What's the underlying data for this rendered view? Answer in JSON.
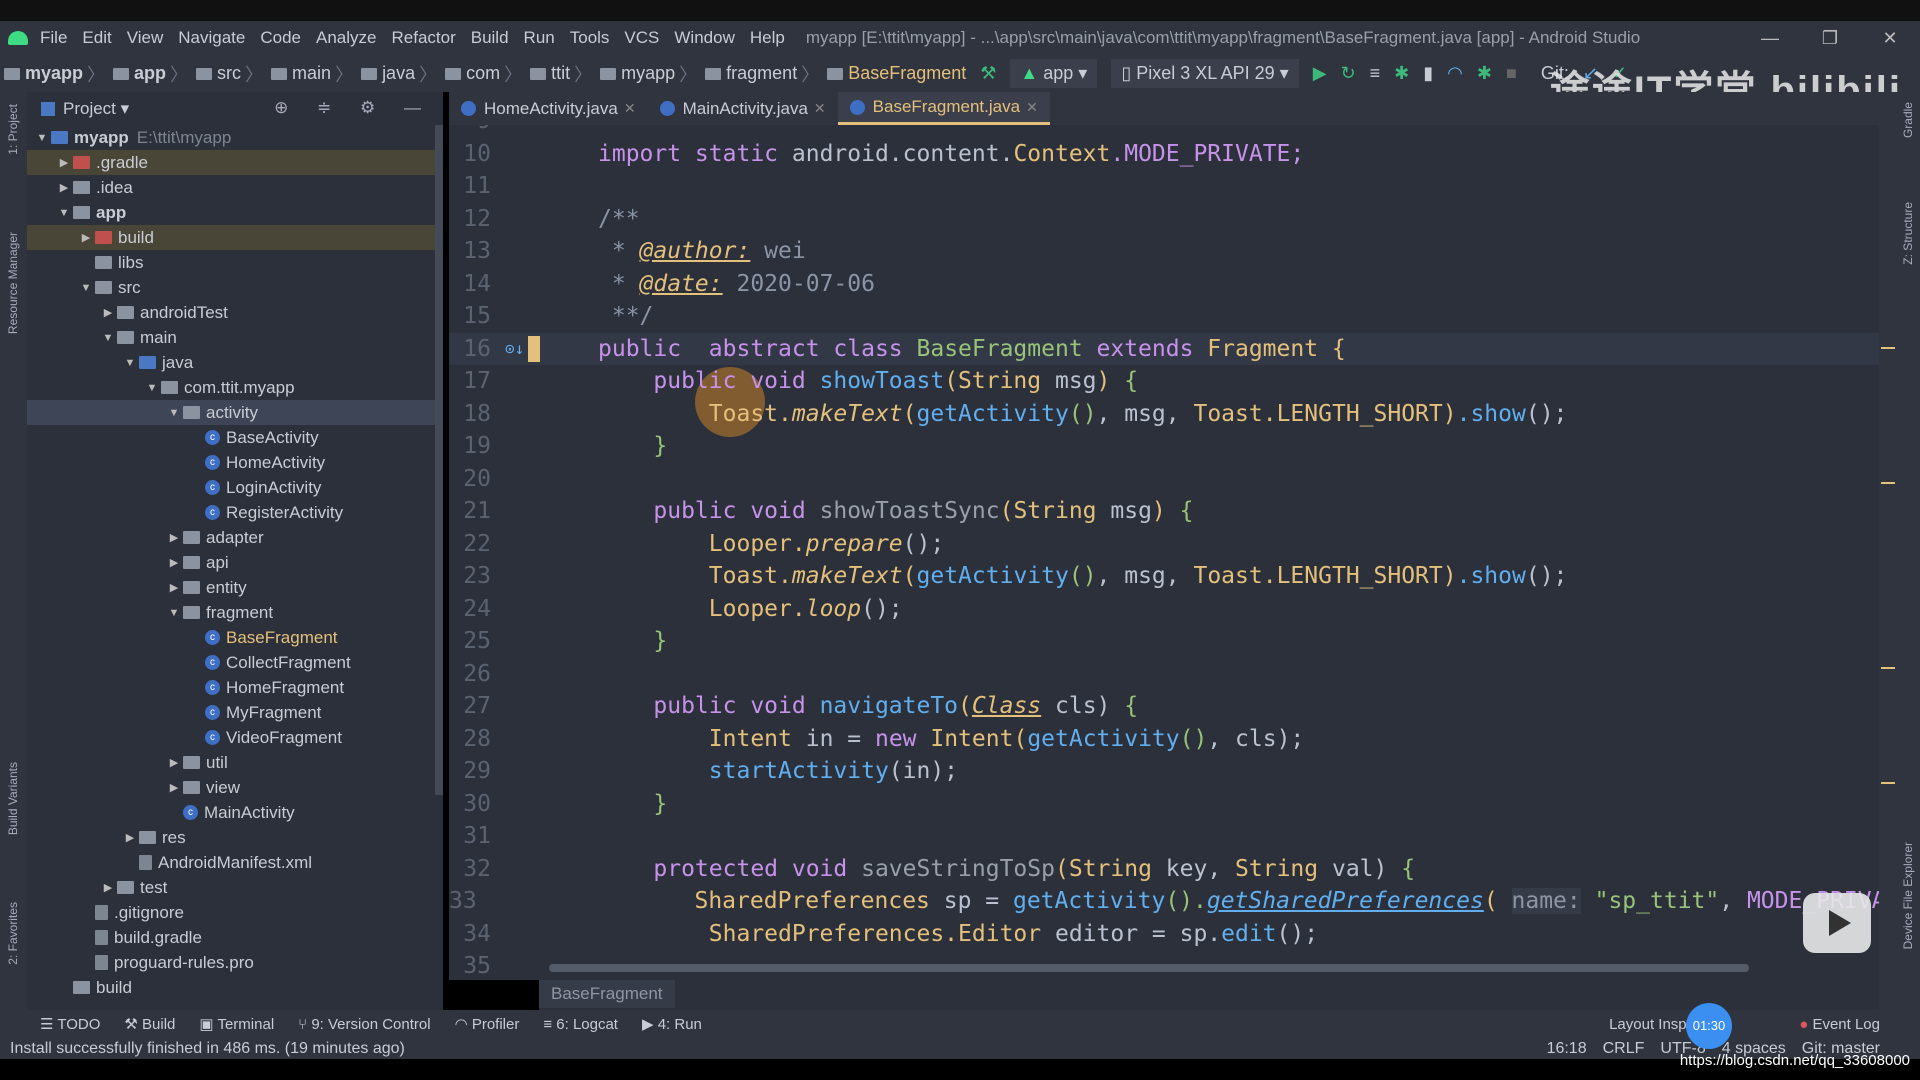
{
  "menu": {
    "items": [
      "File",
      "Edit",
      "View",
      "Navigate",
      "Code",
      "Analyze",
      "Refactor",
      "Build",
      "Run",
      "Tools",
      "VCS",
      "Window",
      "Help"
    ],
    "title": "myapp [E:\\ttit\\myapp] - ...\\app\\src\\main\\java\\com\\ttit\\myapp\\fragment\\BaseFragment.java [app] - Android Studio"
  },
  "breadcrumb": [
    "myapp",
    "app",
    "src",
    "main",
    "java",
    "com",
    "ttit",
    "myapp",
    "fragment",
    "BaseFragment"
  ],
  "toolbar": {
    "run_config": "app",
    "device": "Pixel 3 XL API 29",
    "git_label": "Git:"
  },
  "watermark": "途途IT学堂 bilibili",
  "project": {
    "title": "Project",
    "tree": [
      {
        "d": 0,
        "a": "▼",
        "i": "folderblue",
        "l": "myapp",
        "path": "E:\\ttit\\myapp",
        "b": true
      },
      {
        "d": 1,
        "a": "▶",
        "i": "folderred",
        "l": ".gradle",
        "hl": true
      },
      {
        "d": 1,
        "a": "▶",
        "i": "folder",
        "l": ".idea"
      },
      {
        "d": 1,
        "a": "▼",
        "i": "folder",
        "l": "app",
        "b": true
      },
      {
        "d": 2,
        "a": "▶",
        "i": "folderred",
        "l": "build",
        "hl": true
      },
      {
        "d": 2,
        "a": "",
        "i": "folder",
        "l": "libs"
      },
      {
        "d": 2,
        "a": "▼",
        "i": "folder",
        "l": "src"
      },
      {
        "d": 3,
        "a": "▶",
        "i": "folder",
        "l": "androidTest"
      },
      {
        "d": 3,
        "a": "▼",
        "i": "folder",
        "l": "main"
      },
      {
        "d": 4,
        "a": "▼",
        "i": "folderblue",
        "l": "java"
      },
      {
        "d": 5,
        "a": "▼",
        "i": "folder",
        "l": "com.ttit.myapp"
      },
      {
        "d": 6,
        "a": "▼",
        "i": "folder",
        "l": "activity",
        "sel": true
      },
      {
        "d": 7,
        "a": "",
        "i": "cls",
        "l": "BaseActivity"
      },
      {
        "d": 7,
        "a": "",
        "i": "cls",
        "l": "HomeActivity"
      },
      {
        "d": 7,
        "a": "",
        "i": "cls",
        "l": "LoginActivity"
      },
      {
        "d": 7,
        "a": "",
        "i": "cls",
        "l": "RegisterActivity"
      },
      {
        "d": 6,
        "a": "▶",
        "i": "folder",
        "l": "adapter"
      },
      {
        "d": 6,
        "a": "▶",
        "i": "folder",
        "l": "api"
      },
      {
        "d": 6,
        "a": "▶",
        "i": "folder",
        "l": "entity"
      },
      {
        "d": 6,
        "a": "▼",
        "i": "folder",
        "l": "fragment"
      },
      {
        "d": 7,
        "a": "",
        "i": "cls",
        "l": "BaseFragment",
        "active": true
      },
      {
        "d": 7,
        "a": "",
        "i": "cls",
        "l": "CollectFragment"
      },
      {
        "d": 7,
        "a": "",
        "i": "cls",
        "l": "HomeFragment"
      },
      {
        "d": 7,
        "a": "",
        "i": "cls",
        "l": "MyFragment"
      },
      {
        "d": 7,
        "a": "",
        "i": "cls",
        "l": "VideoFragment"
      },
      {
        "d": 6,
        "a": "▶",
        "i": "folder",
        "l": "util"
      },
      {
        "d": 6,
        "a": "▶",
        "i": "folder",
        "l": "view"
      },
      {
        "d": 6,
        "a": "",
        "i": "cls",
        "l": "MainActivity"
      },
      {
        "d": 4,
        "a": "▶",
        "i": "folder",
        "l": "res"
      },
      {
        "d": 4,
        "a": "",
        "i": "file",
        "l": "AndroidManifest.xml"
      },
      {
        "d": 3,
        "a": "▶",
        "i": "folder",
        "l": "test"
      },
      {
        "d": 2,
        "a": "",
        "i": "file",
        "l": ".gitignore"
      },
      {
        "d": 2,
        "a": "",
        "i": "file",
        "l": "build.gradle"
      },
      {
        "d": 2,
        "a": "",
        "i": "file",
        "l": "proguard-rules.pro"
      },
      {
        "d": 1,
        "a": "",
        "i": "folder",
        "l": "build"
      }
    ]
  },
  "left_tools": [
    "1: Project",
    "Resource Manager",
    "Build Variants",
    "2: Favorites"
  ],
  "right_tools": [
    "Gradle",
    "Z: Structure",
    "Device File Explorer"
  ],
  "tabs": [
    {
      "label": "HomeActivity.java"
    },
    {
      "label": "MainActivity.java"
    },
    {
      "label": "BaseFragment.java",
      "active": true
    }
  ],
  "code": [
    {
      "n": "9",
      "t": []
    },
    {
      "n": "10",
      "t": [
        [
          "import static ",
          "k"
        ],
        [
          "android.content.",
          "p"
        ],
        [
          "Context",
          "t"
        ],
        [
          ".MODE_PRIVATE;",
          "k"
        ]
      ]
    },
    {
      "n": "11",
      "t": []
    },
    {
      "n": "12",
      "t": [
        [
          "/**",
          "cm"
        ]
      ]
    },
    {
      "n": "13",
      "t": [
        [
          " * ",
          "cm"
        ],
        [
          "@author:",
          "ct"
        ],
        [
          " wei",
          "cm"
        ]
      ]
    },
    {
      "n": "14",
      "t": [
        [
          " * ",
          "cm"
        ],
        [
          "@date:",
          "ct"
        ],
        [
          " 2020-07-06",
          "cm"
        ]
      ]
    },
    {
      "n": "15",
      "t": [
        [
          " **/",
          "cm"
        ]
      ]
    },
    {
      "n": "16",
      "cur": true,
      "t": [
        [
          "public  abstract ",
          "k"
        ],
        [
          "class ",
          "k"
        ],
        [
          "BaseFragment ",
          "cn"
        ],
        [
          "extends ",
          "k"
        ],
        [
          "Fragment ",
          "t"
        ],
        [
          "{",
          "t"
        ]
      ]
    },
    {
      "n": "17",
      "t": [
        [
          "    public void ",
          "k"
        ],
        [
          "showToast",
          "m"
        ],
        [
          "(",
          "t"
        ],
        [
          "String ",
          "t"
        ],
        [
          "msg",
          "p"
        ],
        [
          ") ",
          "t"
        ],
        [
          "{",
          "s"
        ]
      ]
    },
    {
      "n": "18",
      "t": [
        [
          "        Toast.",
          "t"
        ],
        [
          "makeText",
          "t i"
        ],
        [
          "(",
          "t"
        ],
        [
          "getActivity",
          "m"
        ],
        [
          "()",
          "s"
        ],
        [
          ", msg, ",
          "p"
        ],
        [
          "Toast",
          "t"
        ],
        [
          ".LENGTH_SHORT)",
          "t"
        ],
        [
          ".show",
          "m"
        ],
        [
          "();",
          "p"
        ]
      ]
    },
    {
      "n": "19",
      "t": [
        [
          "    }",
          "s"
        ]
      ]
    },
    {
      "n": "20",
      "t": []
    },
    {
      "n": "21",
      "t": [
        [
          "    public void ",
          "k"
        ],
        [
          "showToastSync",
          "g"
        ],
        [
          "(",
          "t"
        ],
        [
          "String ",
          "t"
        ],
        [
          "msg",
          "p"
        ],
        [
          ") ",
          "t"
        ],
        [
          "{",
          "s"
        ]
      ]
    },
    {
      "n": "22",
      "t": [
        [
          "        Looper.",
          "t"
        ],
        [
          "prepare",
          "t i"
        ],
        [
          "();",
          "p"
        ]
      ]
    },
    {
      "n": "23",
      "t": [
        [
          "        Toast.",
          "t"
        ],
        [
          "makeText",
          "t i"
        ],
        [
          "(",
          "t"
        ],
        [
          "getActivity",
          "m"
        ],
        [
          "()",
          "s"
        ],
        [
          ", msg, ",
          "p"
        ],
        [
          "Toast",
          "t"
        ],
        [
          ".LENGTH_SHORT)",
          "t"
        ],
        [
          ".show",
          "m"
        ],
        [
          "();",
          "p"
        ]
      ]
    },
    {
      "n": "24",
      "t": [
        [
          "        Looper.",
          "t"
        ],
        [
          "loop",
          "t i"
        ],
        [
          "();",
          "p"
        ]
      ]
    },
    {
      "n": "25",
      "t": [
        [
          "    }",
          "s"
        ]
      ]
    },
    {
      "n": "26",
      "t": []
    },
    {
      "n": "27",
      "t": [
        [
          "    public void ",
          "k"
        ],
        [
          "navigateTo",
          "m"
        ],
        [
          "(",
          "t"
        ],
        [
          "Class",
          "t u"
        ],
        [
          " cls) ",
          "p"
        ],
        [
          "{",
          "s"
        ]
      ]
    },
    {
      "n": "28",
      "t": [
        [
          "        Intent ",
          "t"
        ],
        [
          "in = ",
          "p"
        ],
        [
          "new ",
          "k"
        ],
        [
          "Intent",
          "t"
        ],
        [
          "(",
          "t"
        ],
        [
          "getActivity",
          "m"
        ],
        [
          "()",
          "s"
        ],
        [
          ", cls);",
          "p"
        ]
      ]
    },
    {
      "n": "29",
      "t": [
        [
          "        startActivity",
          "m"
        ],
        [
          "(in);",
          "p"
        ]
      ]
    },
    {
      "n": "30",
      "t": [
        [
          "    }",
          "s"
        ]
      ]
    },
    {
      "n": "31",
      "t": []
    },
    {
      "n": "32",
      "t": [
        [
          "    protected void ",
          "k"
        ],
        [
          "saveStringToSp",
          "g"
        ],
        [
          "(",
          "t"
        ],
        [
          "String ",
          "t"
        ],
        [
          "key, ",
          "p"
        ],
        [
          "String ",
          "t"
        ],
        [
          "val) ",
          "p"
        ],
        [
          "{",
          "s"
        ]
      ]
    },
    {
      "n": "33",
      "t": [
        [
          "        SharedPreferences ",
          "t"
        ],
        [
          "sp = ",
          "p"
        ],
        [
          "getActivity",
          "m"
        ],
        [
          "().",
          "s"
        ],
        [
          "getSharedPreferences",
          "m u"
        ],
        [
          "( ",
          "t"
        ],
        [
          "name:",
          "pl"
        ],
        [
          " \"sp_ttit\"",
          "s"
        ],
        [
          ", ",
          "p"
        ],
        [
          "MODE_PRIVATE)",
          "k"
        ]
      ]
    },
    {
      "n": "34",
      "t": [
        [
          "        SharedPreferences.Editor ",
          "t"
        ],
        [
          "editor = sp.",
          "p"
        ],
        [
          "edit",
          "m"
        ],
        [
          "();",
          "p"
        ]
      ]
    },
    {
      "n": "35",
      "t": []
    }
  ],
  "editor_breadcrumb": "BaseFragment",
  "tool_windows": [
    "TODO",
    "Build",
    "Terminal",
    "9: Version Control",
    "Profiler",
    "6: Logcat",
    "4: Run"
  ],
  "tool_windows_right": [
    "Layout Inspector",
    "Event Log"
  ],
  "status": {
    "message": "Install successfully finished in 486 ms. (19 minutes ago)",
    "position": "16:18",
    "line_sep": "CRLF",
    "encoding": "UTF-8",
    "indent": "4 spaces",
    "git": "Git: master"
  },
  "overlay": {
    "timer": "01:30",
    "url": "https://blog.csdn.net/qq_33608000"
  }
}
